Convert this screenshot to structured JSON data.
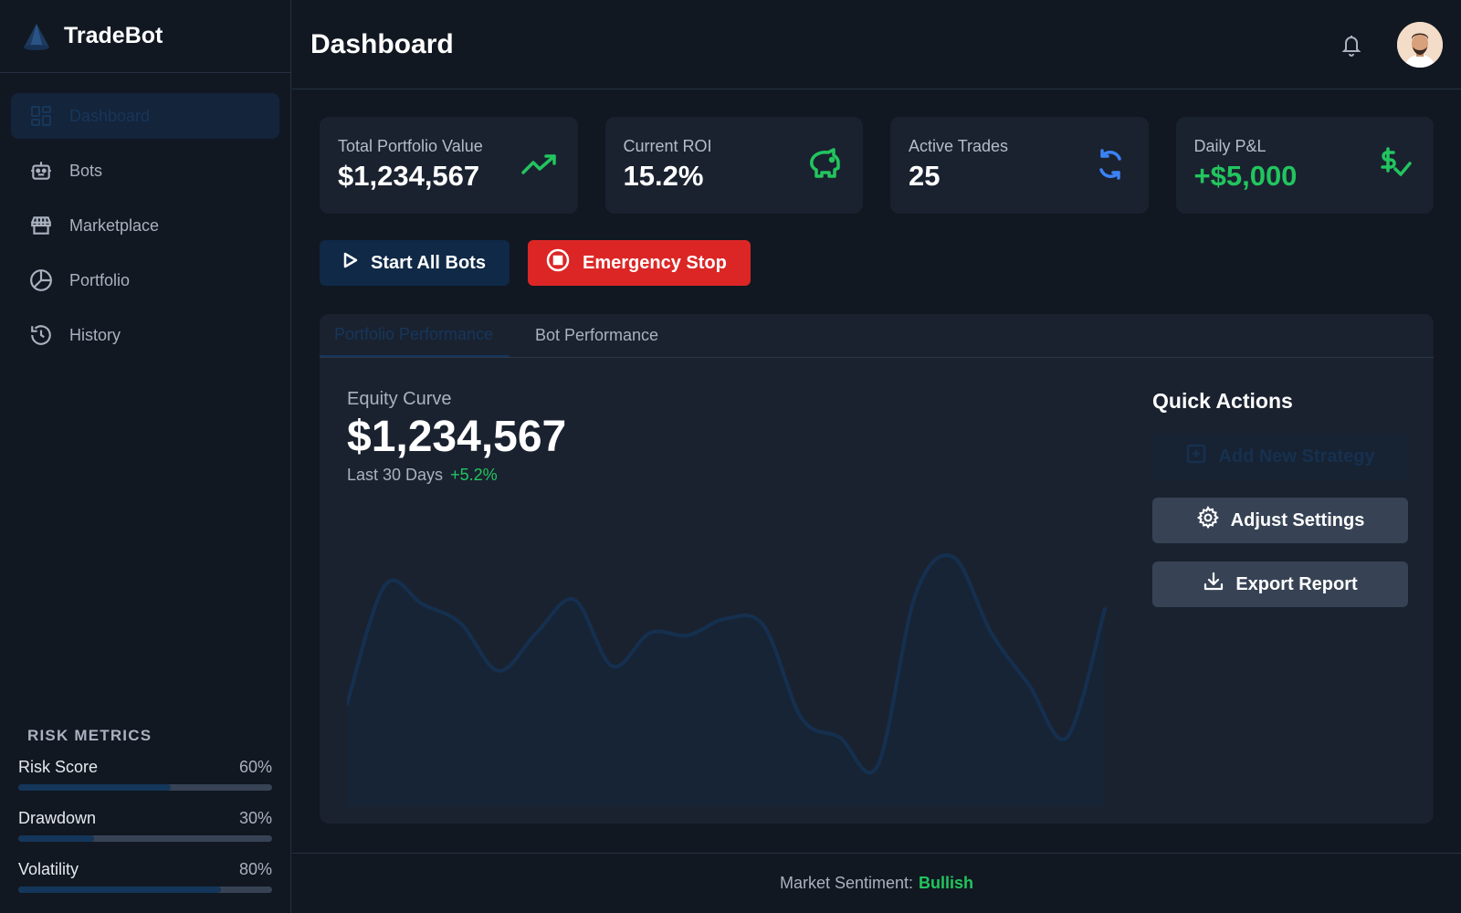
{
  "app": {
    "name": "TradeBot"
  },
  "sidebar": {
    "items": [
      {
        "label": "Dashboard",
        "icon": "dashboard-icon",
        "active": true
      },
      {
        "label": "Bots",
        "icon": "robot-icon",
        "active": false
      },
      {
        "label": "Marketplace",
        "icon": "store-icon",
        "active": false
      },
      {
        "label": "Portfolio",
        "icon": "pie-chart-icon",
        "active": false
      },
      {
        "label": "History",
        "icon": "history-icon",
        "active": false
      }
    ],
    "risk": {
      "title": "RISK METRICS",
      "metrics": [
        {
          "label": "Risk Score",
          "value": "60%",
          "level": 0.6
        },
        {
          "label": "Drawdown",
          "value": "30%",
          "level": 0.3
        },
        {
          "label": "Volatility",
          "value": "80%",
          "level": 0.8
        }
      ]
    }
  },
  "header": {
    "title": "Dashboard"
  },
  "stats": [
    {
      "label": "Total Portfolio Value",
      "value": "$1,234,567",
      "icon": "trending-up-icon",
      "color": "#22c55e"
    },
    {
      "label": "Current ROI",
      "value": "15.2%",
      "icon": "piggy-bank-icon",
      "color": "#22c55e"
    },
    {
      "label": "Active Trades",
      "value": "25",
      "icon": "refresh-icon",
      "color": "#3b82f6"
    },
    {
      "label": "Daily P&L",
      "value": "+$5,000",
      "icon": "dollar-check-icon",
      "color": "#22c55e"
    }
  ],
  "actions": {
    "start_label": "Start All Bots",
    "stop_label": "Emergency Stop"
  },
  "tabs": [
    {
      "label": "Portfolio Performance",
      "active": true
    },
    {
      "label": "Bot Performance",
      "active": false
    }
  ],
  "equity": {
    "label": "Equity Curve",
    "value": "$1,234,567",
    "period": "Last 30 Days",
    "change": "+5.2%"
  },
  "quick_actions": {
    "title": "Quick Actions",
    "add_label": "Add New Strategy",
    "settings_label": "Adjust Settings",
    "export_label": "Export Report"
  },
  "footer": {
    "label": "Market Sentiment:",
    "value": "Bullish"
  },
  "colors": {
    "accent": "#22c55e",
    "danger": "#dc2626",
    "primary_dark": "#0f2947",
    "blue": "#3b82f6"
  },
  "chart_data": {
    "type": "area",
    "x": [
      0,
      1,
      2,
      3,
      4,
      5,
      6,
      7,
      8,
      9,
      10,
      11,
      12,
      13,
      14,
      15,
      16,
      17,
      18,
      19,
      20,
      21,
      22,
      23,
      24,
      25,
      26,
      27,
      28,
      29
    ],
    "values": [
      0.28,
      0.78,
      0.7,
      0.62,
      0.42,
      0.58,
      0.72,
      0.44,
      0.58,
      0.57,
      0.64,
      0.61,
      0.22,
      0.14,
      0.02,
      0.74,
      0.9,
      0.58,
      0.36,
      0.14,
      0.68
    ]
  }
}
